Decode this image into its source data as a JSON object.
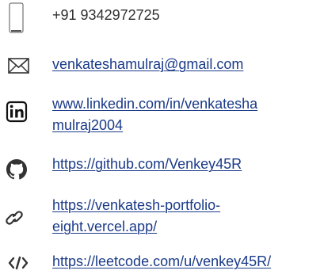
{
  "contacts": {
    "phone": {
      "icon": "smartphone-icon",
      "text": "+91 9342972725"
    },
    "email": {
      "icon": "mail-icon",
      "text": "venkateshamulraj@gmail.com"
    },
    "linkedin": {
      "icon": "linkedin-icon",
      "line1": "www.linkedin.com/in/venkatesha",
      "line2": "mulraj2004"
    },
    "github": {
      "icon": "github-icon",
      "text": "https://github.com/Venkey45R"
    },
    "portfolio": {
      "icon": "link-icon",
      "line1": "https://venkatesh-portfolio-",
      "line2": "eight.vercel.app/"
    },
    "leetcode": {
      "icon": "code-icon",
      "text": "https://leetcode.com/u/venkey45R/"
    }
  },
  "colors": {
    "text": "#2f2f2f",
    "link": "#1a3a88",
    "icon": "#333333"
  }
}
